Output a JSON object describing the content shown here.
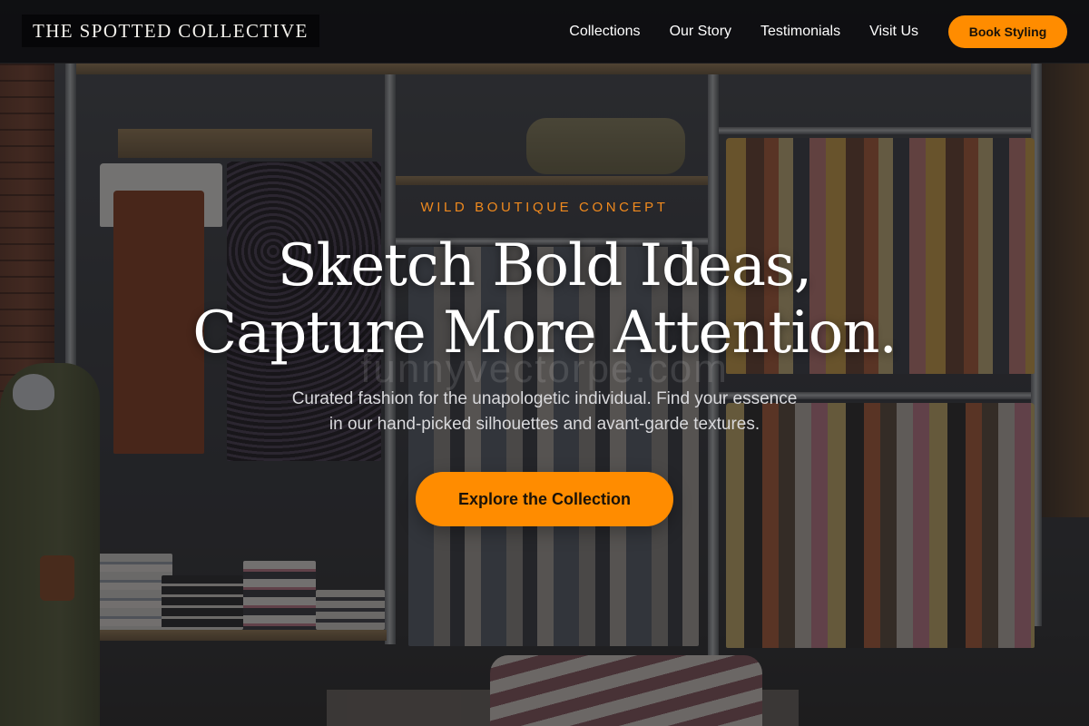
{
  "brand": {
    "name": "THE SPOTTED COLLECTIVE"
  },
  "nav": {
    "links": [
      "Collections",
      "Our Story",
      "Testimonials",
      "Visit Us"
    ],
    "cta_label": "Book Styling"
  },
  "hero": {
    "eyebrow": "WILD BOUTIQUE CONCEPT",
    "headline_line1": "Sketch Bold Ideas,",
    "headline_line2": "Capture More Attention.",
    "watermark": "funnyvectorpe.com",
    "subtext_line1": "Curated fashion for the unapologetic individual. Find your essence",
    "subtext_line2": "in our hand-picked silhouettes and avant-garde textures.",
    "cta_label": "Explore the Collection"
  },
  "colors": {
    "accent": "#ff8c00",
    "eyebrow": "#f08a1e",
    "nav_background": "#0a0a0c"
  }
}
